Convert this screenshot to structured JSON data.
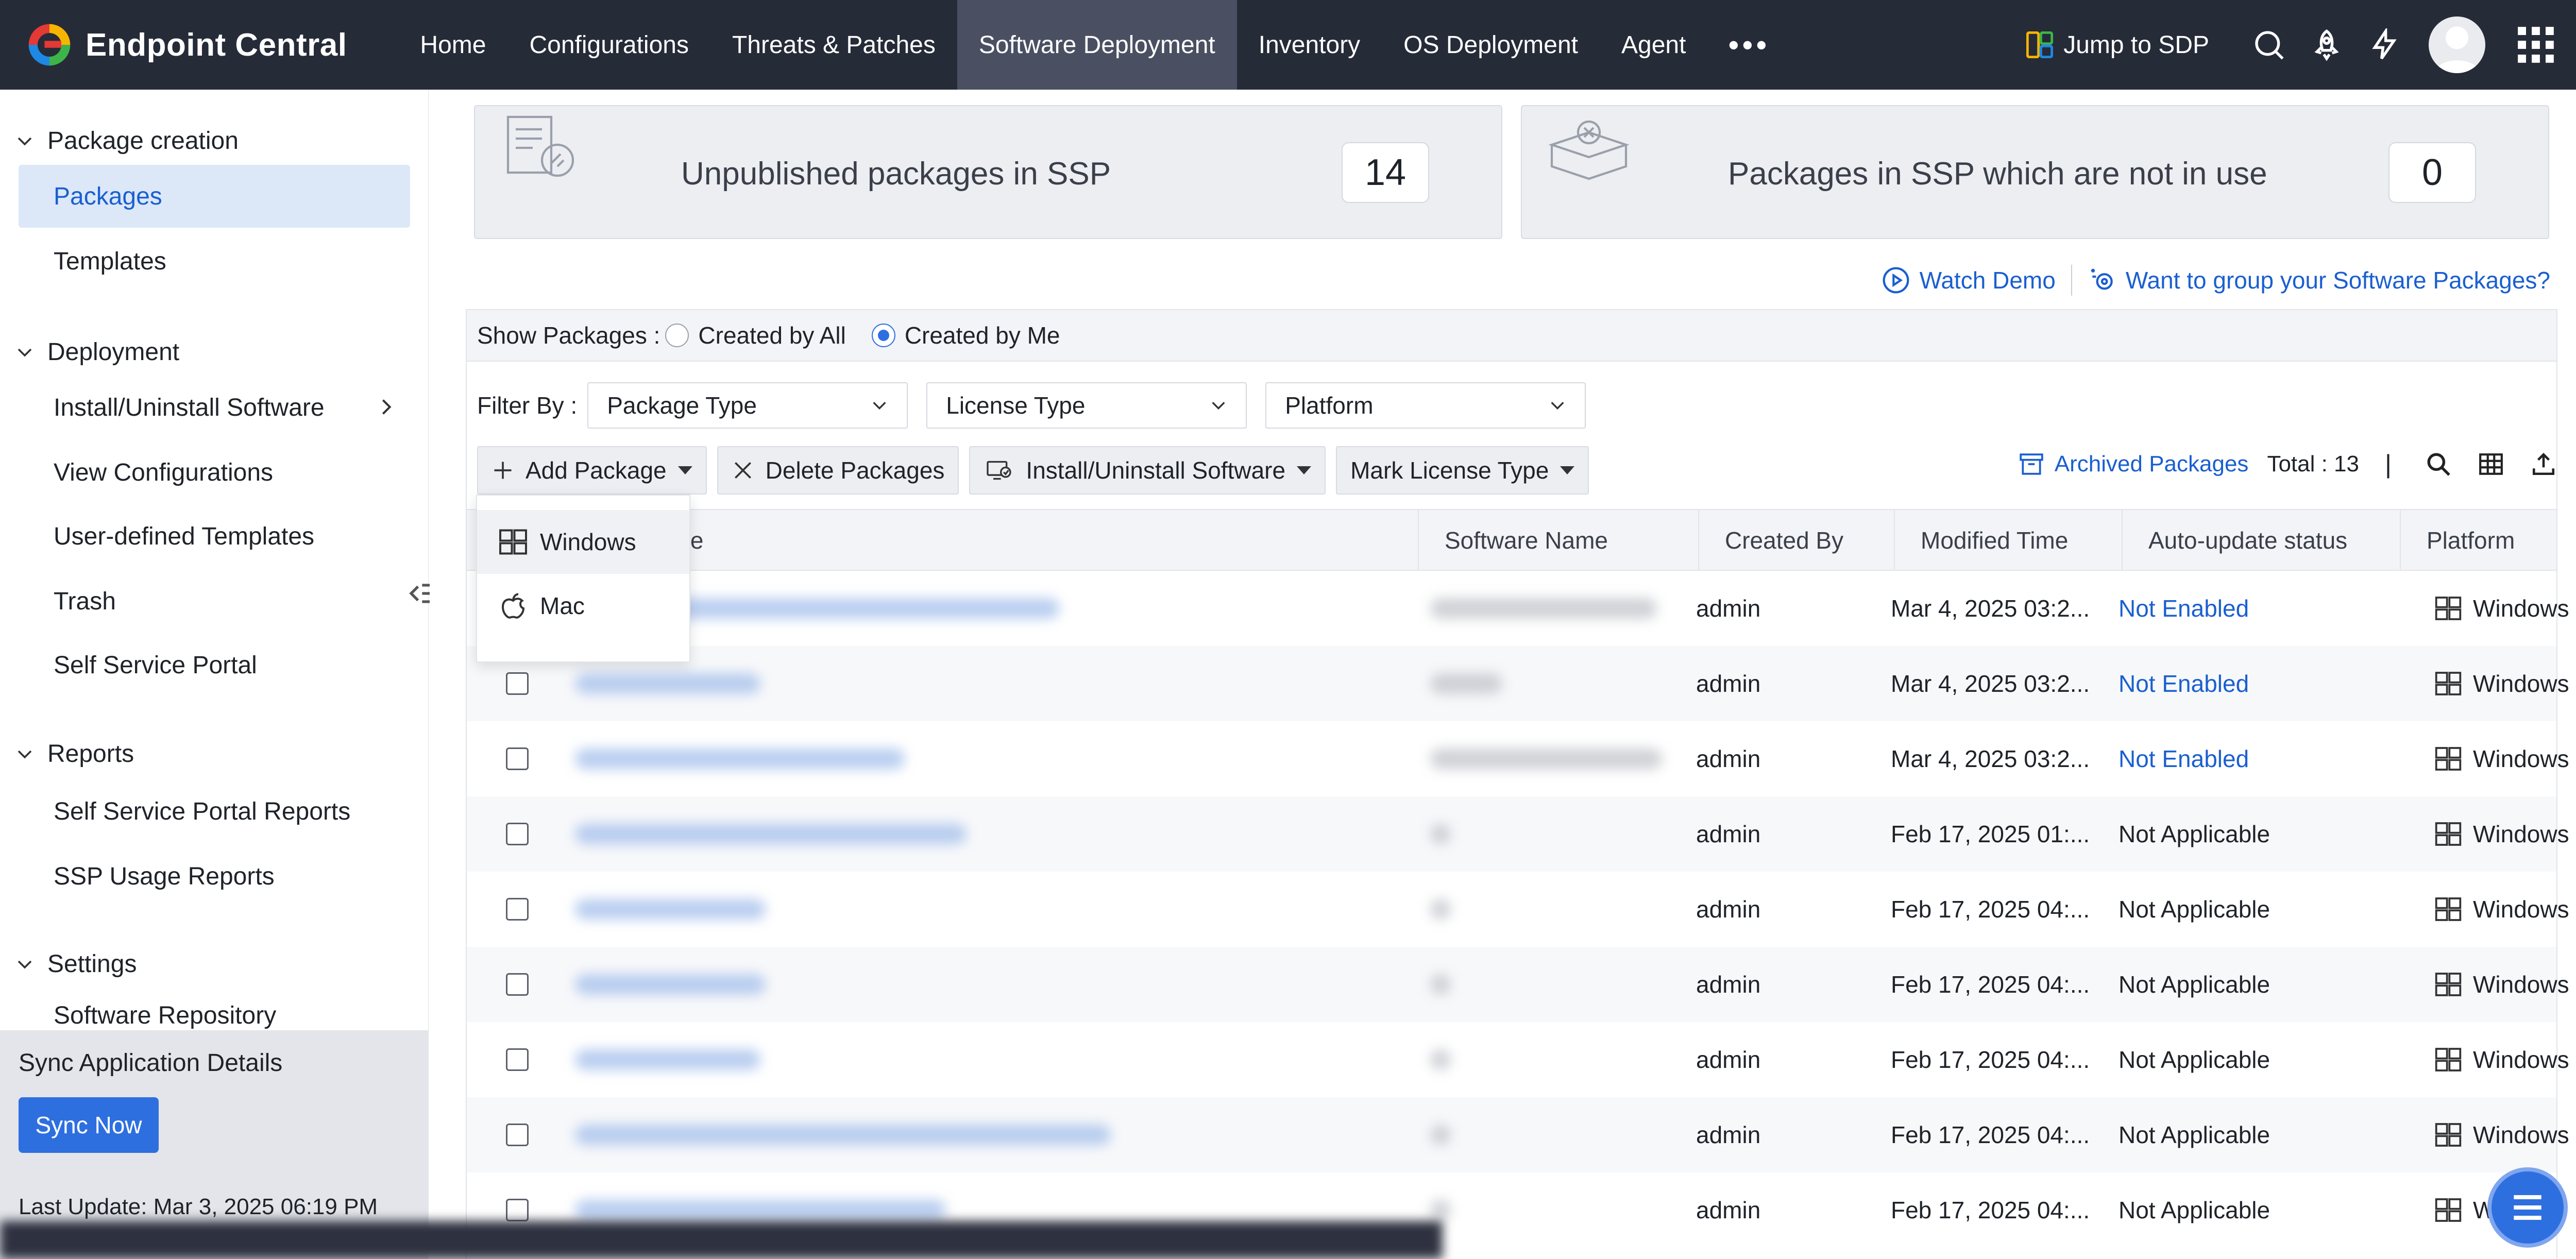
{
  "app": {
    "name": "Endpoint Central"
  },
  "nav": {
    "items": [
      "Home",
      "Configurations",
      "Threats & Patches",
      "Software Deployment",
      "Inventory",
      "OS Deployment",
      "Agent"
    ],
    "more": "•••",
    "active": "Software Deployment",
    "jump": "Jump to SDP"
  },
  "sidebar": {
    "groups": {
      "package_creation": "Package creation",
      "deployment": "Deployment",
      "reports": "Reports",
      "settings": "Settings"
    },
    "items": {
      "packages": "Packages",
      "templates": "Templates",
      "install_uninstall": "Install/Uninstall Software",
      "view_configurations": "View Configurations",
      "user_defined_templates": "User-defined Templates",
      "trash": "Trash",
      "self_service_portal": "Self Service Portal",
      "ssp_reports": "Self Service Portal Reports",
      "ssp_usage_reports": "SSP Usage Reports",
      "software_repository": "Software Repository"
    },
    "sync": {
      "title": "Sync Application Details",
      "button": "Sync Now",
      "last_update": "Last Update: Mar 3, 2025 06:19 PM"
    }
  },
  "cards": {
    "unpublished": {
      "label": "Unpublished packages in SSP",
      "count": "14"
    },
    "not_in_use": {
      "label": "Packages in SSP which are not in use",
      "count": "0"
    }
  },
  "links": {
    "watch_demo": "Watch Demo",
    "group": "Want to group your Software Packages?"
  },
  "filters": {
    "show_label": "Show Packages :",
    "created_by_all": "Created by All",
    "created_by_me": "Created by Me",
    "filter_label": "Filter By :",
    "package_type": "Package Type",
    "license_type": "License Type",
    "platform": "Platform"
  },
  "toolbar": {
    "add_package": "Add Package",
    "delete_packages": "Delete Packages",
    "install_uninstall": "Install/Uninstall Software",
    "mark_license": "Mark License Type",
    "archived": "Archived Packages",
    "total": "Total : 13",
    "separator": "|"
  },
  "dropdown": {
    "windows": "Windows",
    "mac": "Mac"
  },
  "table": {
    "headers": [
      "ame",
      "Software Name",
      "Created By",
      "Modified Time",
      "Auto-update status",
      "Platform"
    ],
    "rows": [
      {
        "created_by": "admin",
        "modified": "Mar 4, 2025 03:2...",
        "status": "Not Enabled",
        "platform": "Windows"
      },
      {
        "created_by": "admin",
        "modified": "Mar 4, 2025 03:2...",
        "status": "Not Enabled",
        "platform": "Windows"
      },
      {
        "created_by": "admin",
        "modified": "Mar 4, 2025 03:2...",
        "status": "Not Enabled",
        "platform": "Windows"
      },
      {
        "created_by": "admin",
        "modified": "Feb 17, 2025 01:...",
        "status": "Not Applicable",
        "platform": "Windows"
      },
      {
        "created_by": "admin",
        "modified": "Feb 17, 2025 04:...",
        "status": "Not Applicable",
        "platform": "Windows"
      },
      {
        "created_by": "admin",
        "modified": "Feb 17, 2025 04:...",
        "status": "Not Applicable",
        "platform": "Windows"
      },
      {
        "created_by": "admin",
        "modified": "Feb 17, 2025 04:...",
        "status": "Not Applicable",
        "platform": "Windows"
      },
      {
        "created_by": "admin",
        "modified": "Feb 17, 2025 04:...",
        "status": "Not Applicable",
        "platform": "Windows"
      },
      {
        "created_by": "admin",
        "modified": "Feb 17, 2025 04:...",
        "status": "Not Applicable",
        "platform": "Windo"
      }
    ]
  },
  "colors": {
    "topbar": "#262b38",
    "nav_active": "#4a5062",
    "accent": "#2e6fe0",
    "link": "#1a5fd0",
    "sidebar_active": "#dce8f8"
  }
}
